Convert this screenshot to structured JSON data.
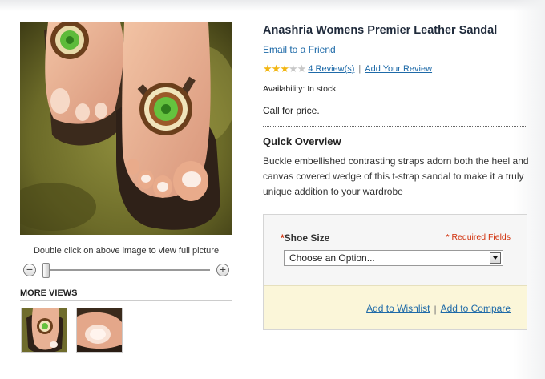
{
  "product": {
    "name": "Anashria Womens Premier Leather Sandal",
    "email_link": "Email to a Friend",
    "rating": {
      "stars_filled": 3,
      "stars_total": 5,
      "reviews_link": "4 Review(s)",
      "add_review_link": "Add Your Review",
      "separator": "|"
    },
    "availability": "Availability: In stock",
    "price_note": "Call for price."
  },
  "overview": {
    "title": "Quick Overview",
    "text": "Buckle embellished contrasting straps adorn both the heel and canvas covered wedge of this t-strap sandal to make it a truly unique addition to your wardrobe"
  },
  "media": {
    "zoom_hint": "Double click on above image to view  full picture",
    "zoom_out_icon": "minus-icon",
    "zoom_in_icon": "plus-icon",
    "zoom_out_glyph": "−",
    "zoom_in_glyph": "+",
    "more_views_title": "MORE VIEWS"
  },
  "options": {
    "required_mark": "*",
    "shoe_size_label": "Shoe Size",
    "required_fields_note": "* Required Fields",
    "select_value": "Choose an Option..."
  },
  "actions": {
    "wishlist_link": "Add to Wishlist",
    "separator": "|",
    "compare_link": "Add to Compare"
  },
  "colors": {
    "link": "#1e6aa8",
    "required": "#d12f0a",
    "star": "#f2b613",
    "actions_bg": "#fbf6d9"
  }
}
